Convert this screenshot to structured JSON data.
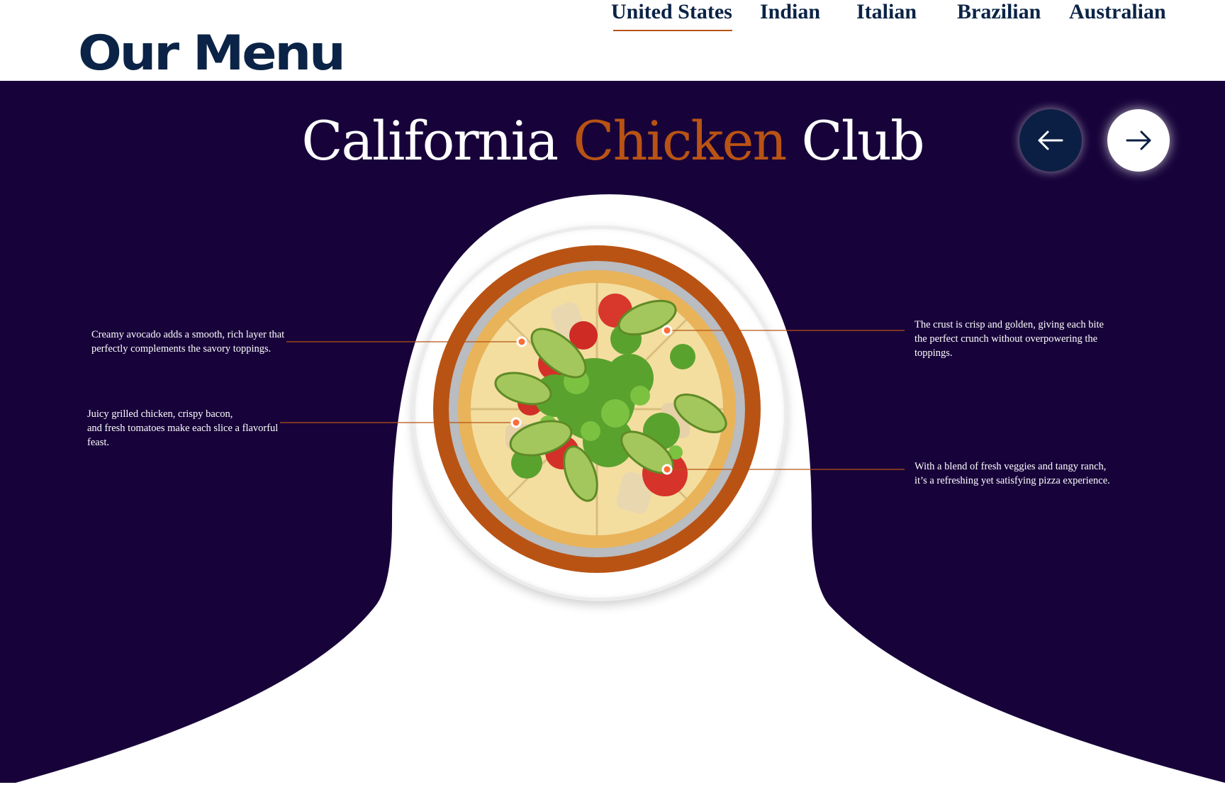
{
  "header": {
    "logo": "Our Menu",
    "nav": [
      {
        "label": "United States",
        "active": true
      },
      {
        "label": "Indian",
        "active": false
      },
      {
        "label": "Italian",
        "active": false
      },
      {
        "label": "Brazilian",
        "active": false
      },
      {
        "label": "Australian",
        "active": false
      }
    ]
  },
  "dish": {
    "title_part1": "California",
    "title_accent": "Chicken",
    "title_part2": "Club"
  },
  "carousel": {
    "prev_icon": "arrow-left-icon",
    "next_icon": "arrow-right-icon"
  },
  "callouts": {
    "avocado": [
      "Creamy avocado adds a smooth, rich layer that",
      "perfectly complements the savory toppings."
    ],
    "chicken": [
      "Juicy grilled chicken, crispy bacon,",
      "and fresh tomatoes make each slice a flavorful",
      "feast."
    ],
    "crust": [
      "The crust is crisp and golden, giving each bite",
      "the perfect crunch without overpowering the",
      "toppings."
    ],
    "veggies": [
      "With a blend of fresh veggies and tangy ranch,",
      "it’s a refreshing yet satisfying pizza experience."
    ]
  },
  "colors": {
    "navy_text": "#0b2346",
    "background_purple": "#17033a",
    "accent_orange": "#b95314",
    "white": "#ffffff"
  }
}
